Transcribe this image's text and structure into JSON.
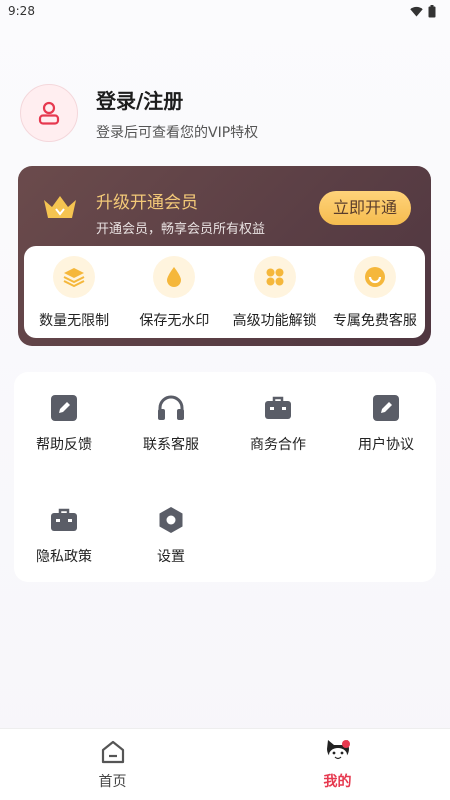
{
  "status_bar": {
    "time": "9:28"
  },
  "profile": {
    "title": "登录/注册",
    "subtitle": "登录后可查看您的VIP特权"
  },
  "vip": {
    "title": "升级开通会员",
    "subtitle": "开通会员，畅享会员所有权益",
    "button": "立即开通",
    "benefits": [
      {
        "label": "数量无限制",
        "icon": "layers-icon"
      },
      {
        "label": "保存无水印",
        "icon": "droplet-icon"
      },
      {
        "label": "高级功能解锁",
        "icon": "apps-icon"
      },
      {
        "label": "专属免费客服",
        "icon": "smile-icon"
      }
    ]
  },
  "services": [
    {
      "label": "帮助反馈",
      "icon": "edit-icon"
    },
    {
      "label": "联系客服",
      "icon": "headphones-icon"
    },
    {
      "label": "商务合作",
      "icon": "briefcase-icon"
    },
    {
      "label": "用户协议",
      "icon": "edit-icon"
    },
    {
      "label": "隐私政策",
      "icon": "briefcase-icon"
    },
    {
      "label": "设置",
      "icon": "settings-icon"
    }
  ],
  "tabbar": {
    "home": "首页",
    "mine": "我的"
  },
  "colors": {
    "accent": "#e6394f",
    "vip_gold": "#f3c978",
    "vip_bg": "#5b3f45"
  }
}
